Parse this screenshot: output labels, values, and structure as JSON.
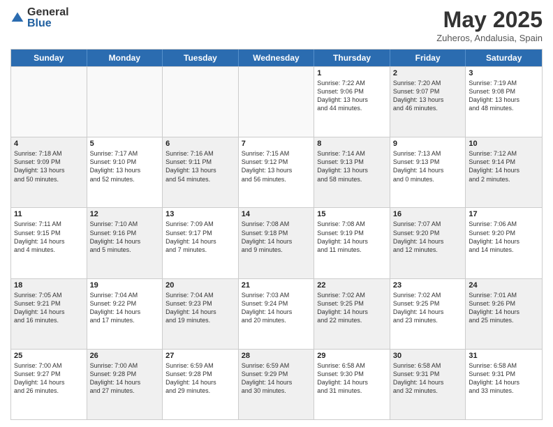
{
  "logo": {
    "general": "General",
    "blue": "Blue"
  },
  "header": {
    "month": "May 2025",
    "location": "Zuheros, Andalusia, Spain"
  },
  "days": [
    "Sunday",
    "Monday",
    "Tuesday",
    "Wednesday",
    "Thursday",
    "Friday",
    "Saturday"
  ],
  "rows": [
    [
      {
        "day": "",
        "lines": [],
        "empty": true
      },
      {
        "day": "",
        "lines": [],
        "empty": true
      },
      {
        "day": "",
        "lines": [],
        "empty": true
      },
      {
        "day": "",
        "lines": [],
        "empty": true
      },
      {
        "day": "1",
        "lines": [
          "Sunrise: 7:22 AM",
          "Sunset: 9:06 PM",
          "Daylight: 13 hours",
          "and 44 minutes."
        ]
      },
      {
        "day": "2",
        "lines": [
          "Sunrise: 7:20 AM",
          "Sunset: 9:07 PM",
          "Daylight: 13 hours",
          "and 46 minutes."
        ],
        "shaded": true
      },
      {
        "day": "3",
        "lines": [
          "Sunrise: 7:19 AM",
          "Sunset: 9:08 PM",
          "Daylight: 13 hours",
          "and 48 minutes."
        ]
      }
    ],
    [
      {
        "day": "4",
        "lines": [
          "Sunrise: 7:18 AM",
          "Sunset: 9:09 PM",
          "Daylight: 13 hours",
          "and 50 minutes."
        ],
        "shaded": true
      },
      {
        "day": "5",
        "lines": [
          "Sunrise: 7:17 AM",
          "Sunset: 9:10 PM",
          "Daylight: 13 hours",
          "and 52 minutes."
        ]
      },
      {
        "day": "6",
        "lines": [
          "Sunrise: 7:16 AM",
          "Sunset: 9:11 PM",
          "Daylight: 13 hours",
          "and 54 minutes."
        ],
        "shaded": true
      },
      {
        "day": "7",
        "lines": [
          "Sunrise: 7:15 AM",
          "Sunset: 9:12 PM",
          "Daylight: 13 hours",
          "and 56 minutes."
        ]
      },
      {
        "day": "8",
        "lines": [
          "Sunrise: 7:14 AM",
          "Sunset: 9:13 PM",
          "Daylight: 13 hours",
          "and 58 minutes."
        ],
        "shaded": true
      },
      {
        "day": "9",
        "lines": [
          "Sunrise: 7:13 AM",
          "Sunset: 9:13 PM",
          "Daylight: 14 hours",
          "and 0 minutes."
        ]
      },
      {
        "day": "10",
        "lines": [
          "Sunrise: 7:12 AM",
          "Sunset: 9:14 PM",
          "Daylight: 14 hours",
          "and 2 minutes."
        ],
        "shaded": true
      }
    ],
    [
      {
        "day": "11",
        "lines": [
          "Sunrise: 7:11 AM",
          "Sunset: 9:15 PM",
          "Daylight: 14 hours",
          "and 4 minutes."
        ]
      },
      {
        "day": "12",
        "lines": [
          "Sunrise: 7:10 AM",
          "Sunset: 9:16 PM",
          "Daylight: 14 hours",
          "and 5 minutes."
        ],
        "shaded": true
      },
      {
        "day": "13",
        "lines": [
          "Sunrise: 7:09 AM",
          "Sunset: 9:17 PM",
          "Daylight: 14 hours",
          "and 7 minutes."
        ]
      },
      {
        "day": "14",
        "lines": [
          "Sunrise: 7:08 AM",
          "Sunset: 9:18 PM",
          "Daylight: 14 hours",
          "and 9 minutes."
        ],
        "shaded": true
      },
      {
        "day": "15",
        "lines": [
          "Sunrise: 7:08 AM",
          "Sunset: 9:19 PM",
          "Daylight: 14 hours",
          "and 11 minutes."
        ]
      },
      {
        "day": "16",
        "lines": [
          "Sunrise: 7:07 AM",
          "Sunset: 9:20 PM",
          "Daylight: 14 hours",
          "and 12 minutes."
        ],
        "shaded": true
      },
      {
        "day": "17",
        "lines": [
          "Sunrise: 7:06 AM",
          "Sunset: 9:20 PM",
          "Daylight: 14 hours",
          "and 14 minutes."
        ]
      }
    ],
    [
      {
        "day": "18",
        "lines": [
          "Sunrise: 7:05 AM",
          "Sunset: 9:21 PM",
          "Daylight: 14 hours",
          "and 16 minutes."
        ],
        "shaded": true
      },
      {
        "day": "19",
        "lines": [
          "Sunrise: 7:04 AM",
          "Sunset: 9:22 PM",
          "Daylight: 14 hours",
          "and 17 minutes."
        ]
      },
      {
        "day": "20",
        "lines": [
          "Sunrise: 7:04 AM",
          "Sunset: 9:23 PM",
          "Daylight: 14 hours",
          "and 19 minutes."
        ],
        "shaded": true
      },
      {
        "day": "21",
        "lines": [
          "Sunrise: 7:03 AM",
          "Sunset: 9:24 PM",
          "Daylight: 14 hours",
          "and 20 minutes."
        ]
      },
      {
        "day": "22",
        "lines": [
          "Sunrise: 7:02 AM",
          "Sunset: 9:25 PM",
          "Daylight: 14 hours",
          "and 22 minutes."
        ],
        "shaded": true
      },
      {
        "day": "23",
        "lines": [
          "Sunrise: 7:02 AM",
          "Sunset: 9:25 PM",
          "Daylight: 14 hours",
          "and 23 minutes."
        ]
      },
      {
        "day": "24",
        "lines": [
          "Sunrise: 7:01 AM",
          "Sunset: 9:26 PM",
          "Daylight: 14 hours",
          "and 25 minutes."
        ],
        "shaded": true
      }
    ],
    [
      {
        "day": "25",
        "lines": [
          "Sunrise: 7:00 AM",
          "Sunset: 9:27 PM",
          "Daylight: 14 hours",
          "and 26 minutes."
        ]
      },
      {
        "day": "26",
        "lines": [
          "Sunrise: 7:00 AM",
          "Sunset: 9:28 PM",
          "Daylight: 14 hours",
          "and 27 minutes."
        ],
        "shaded": true
      },
      {
        "day": "27",
        "lines": [
          "Sunrise: 6:59 AM",
          "Sunset: 9:28 PM",
          "Daylight: 14 hours",
          "and 29 minutes."
        ]
      },
      {
        "day": "28",
        "lines": [
          "Sunrise: 6:59 AM",
          "Sunset: 9:29 PM",
          "Daylight: 14 hours",
          "and 30 minutes."
        ],
        "shaded": true
      },
      {
        "day": "29",
        "lines": [
          "Sunrise: 6:58 AM",
          "Sunset: 9:30 PM",
          "Daylight: 14 hours",
          "and 31 minutes."
        ]
      },
      {
        "day": "30",
        "lines": [
          "Sunrise: 6:58 AM",
          "Sunset: 9:31 PM",
          "Daylight: 14 hours",
          "and 32 minutes."
        ],
        "shaded": true
      },
      {
        "day": "31",
        "lines": [
          "Sunrise: 6:58 AM",
          "Sunset: 9:31 PM",
          "Daylight: 14 hours",
          "and 33 minutes."
        ]
      }
    ]
  ]
}
